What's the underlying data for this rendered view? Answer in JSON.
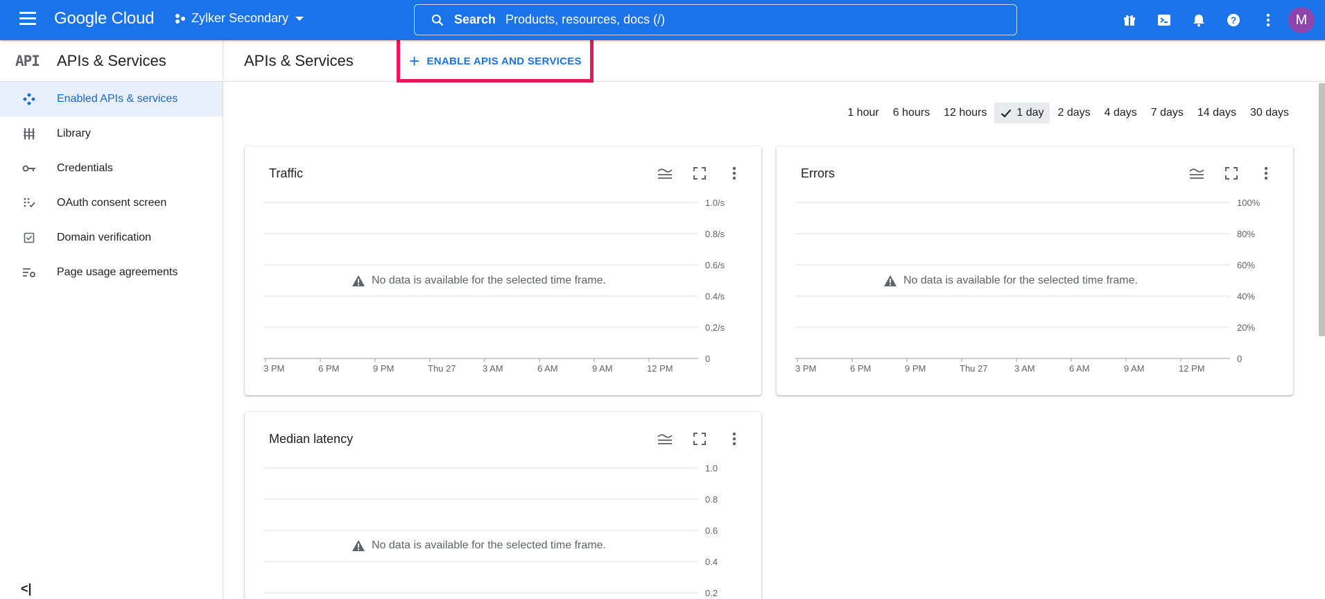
{
  "topbar": {
    "logo": "Google Cloud",
    "project": "Zylker Secondary",
    "search_label": "Search",
    "search_placeholder": "Products, resources, docs (/)",
    "avatar_letter": "M"
  },
  "sidebar": {
    "logo_text": "API",
    "title": "APIs & Services",
    "items": [
      {
        "label": "Enabled APIs & services",
        "icon": "diamond-arrows-icon",
        "active": true
      },
      {
        "label": "Library",
        "icon": "library-icon"
      },
      {
        "label": "Credentials",
        "icon": "key-icon"
      },
      {
        "label": "OAuth consent screen",
        "icon": "consent-icon"
      },
      {
        "label": "Domain verification",
        "icon": "checkbox-icon"
      },
      {
        "label": "Page usage agreements",
        "icon": "settings-list-icon"
      }
    ],
    "collapse_label": "<|"
  },
  "header": {
    "title": "APIs & Services",
    "enable_button": "ENABLE APIS AND SERVICES"
  },
  "time_range": {
    "options": [
      "1 hour",
      "6 hours",
      "12 hours",
      "1 day",
      "2 days",
      "4 days",
      "7 days",
      "14 days",
      "30 days"
    ],
    "selected": "1 day"
  },
  "no_data_text": "No data is available for the selected time frame.",
  "chart_data": [
    {
      "type": "line",
      "title": "Traffic",
      "series": [],
      "x_ticks": [
        "3 PM",
        "6 PM",
        "9 PM",
        "Thu 27",
        "3 AM",
        "6 AM",
        "9 AM",
        "12 PM"
      ],
      "y_ticks": [
        "1.0/s",
        "0.8/s",
        "0.6/s",
        "0.4/s",
        "0.2/s",
        "0"
      ],
      "ylim": [
        0,
        1.0
      ],
      "grid": true
    },
    {
      "type": "line",
      "title": "Errors",
      "series": [],
      "x_ticks": [
        "3 PM",
        "6 PM",
        "9 PM",
        "Thu 27",
        "3 AM",
        "6 AM",
        "9 AM",
        "12 PM"
      ],
      "y_ticks": [
        "100%",
        "80%",
        "60%",
        "40%",
        "20%",
        "0"
      ],
      "ylim": [
        0,
        100
      ],
      "grid": true
    },
    {
      "type": "line",
      "title": "Median latency",
      "series": [],
      "x_ticks": [],
      "y_ticks": [
        "1.0",
        "0.8",
        "0.6",
        "0.4",
        "0.2"
      ],
      "ylim": [
        0,
        1.0
      ],
      "grid": true
    }
  ]
}
